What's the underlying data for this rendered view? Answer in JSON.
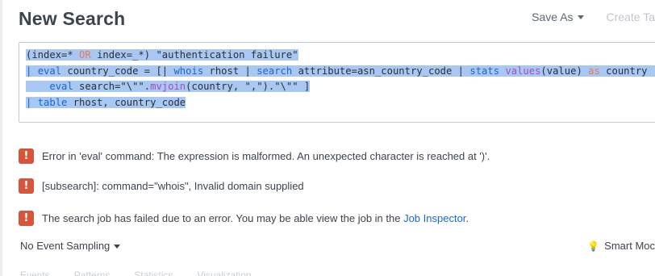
{
  "header": {
    "title": "New Search",
    "save_as": "Save As",
    "create_table": "Create Ta"
  },
  "search": {
    "lines": [
      [
        {
          "t": "(index=* ",
          "c": ""
        },
        {
          "t": "OR",
          "c": "op"
        },
        {
          "t": " index=_*) \"authentication failure\"",
          "c": ""
        }
      ],
      [
        {
          "t": "| ",
          "c": "kw"
        },
        {
          "t": "eval",
          "c": "kw"
        },
        {
          "t": " country_code = [| ",
          "c": ""
        },
        {
          "t": "whois",
          "c": "kw"
        },
        {
          "t": " rhost | ",
          "c": ""
        },
        {
          "t": "search",
          "c": "kw"
        },
        {
          "t": " attribute=asn_country_code | ",
          "c": ""
        },
        {
          "t": "stats",
          "c": "kw"
        },
        {
          "t": " ",
          "c": ""
        },
        {
          "t": "values",
          "c": "fn"
        },
        {
          "t": "(value) ",
          "c": ""
        },
        {
          "t": "as",
          "c": "op"
        },
        {
          "t": " country |",
          "c": ""
        }
      ],
      [
        {
          "t": "    ",
          "c": ""
        },
        {
          "t": "eval",
          "c": "kw"
        },
        {
          "t": " search=\"\\\"\".",
          "c": ""
        },
        {
          "t": "mvjoin",
          "c": "fn"
        },
        {
          "t": "(country, \",\").\"\\\"\" ]",
          "c": ""
        }
      ],
      [
        {
          "t": "| ",
          "c": "kw"
        },
        {
          "t": "table",
          "c": "kw"
        },
        {
          "t": " rhost, country_code",
          "c": ""
        }
      ]
    ]
  },
  "messages": [
    {
      "icon": "!",
      "text": "Error in 'eval' command: The expression is malformed. An unexpected character is reached at ')'."
    },
    {
      "icon": "!",
      "text": "[subsearch]: command=\"whois\", Invalid domain supplied"
    },
    {
      "icon": "!",
      "text": "The search job has failed due to an error. You may be able view the job in the ",
      "link": "Job Inspector",
      "suffix": "."
    }
  ],
  "footer": {
    "sampling": "No Event Sampling",
    "mode": "Smart Moc",
    "tabs": [
      "Events",
      "Patterns",
      "Statistics",
      "Visualization"
    ]
  }
}
